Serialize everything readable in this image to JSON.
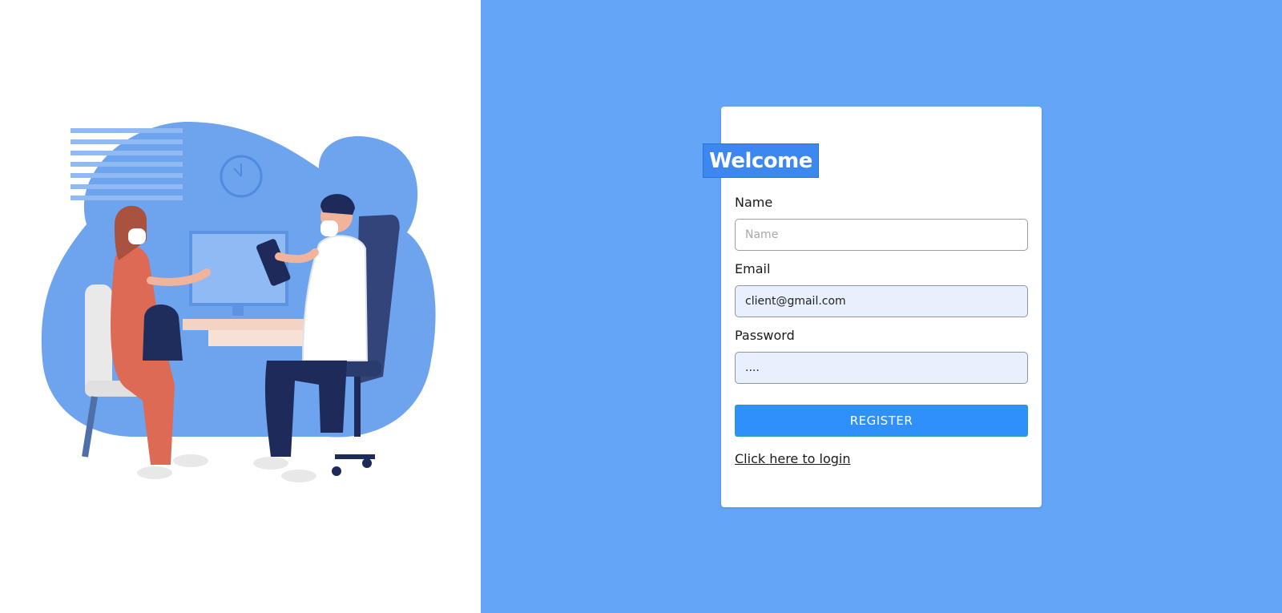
{
  "illustration": {
    "icon": "doctor-patient-consultation-illustration",
    "colors": {
      "blob": "#6ea3ee",
      "blob_light": "#8fbaf3",
      "patient_outfit": "#dc6a55",
      "doctor_pants": "#1e2a5a",
      "chair": "#33447a",
      "coat": "#ffffff"
    }
  },
  "form": {
    "title": "Welcome",
    "name": {
      "label": "Name",
      "value": "",
      "placeholder": "Name"
    },
    "email": {
      "label": "Email",
      "value": "client@gmail.com",
      "placeholder": ""
    },
    "password": {
      "label": "Password",
      "value": "....",
      "placeholder": ""
    },
    "register_label": "REGISTER",
    "login_link": "Click here to login"
  },
  "colors": {
    "background_right": "#64a5f8",
    "badge": "#3d87f0",
    "button": "#2f90fc",
    "autofill": "#e8f0fe"
  }
}
